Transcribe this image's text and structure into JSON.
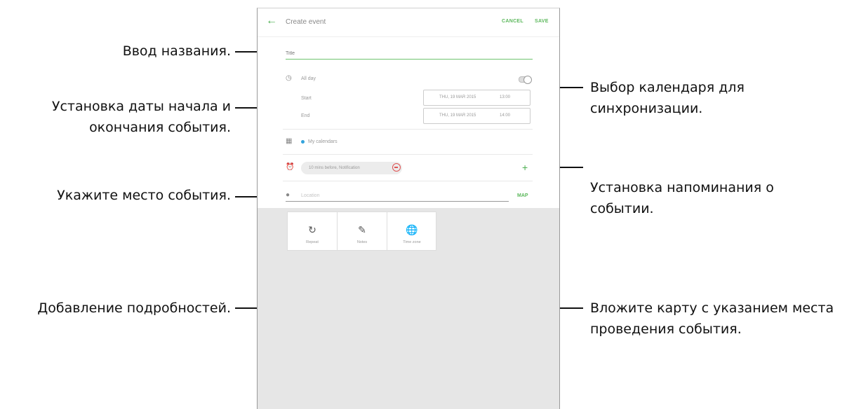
{
  "callouts": {
    "title_input": "Ввод названия.",
    "dates_line1": "Установка даты начала и",
    "dates_line2": "окончания события.",
    "location": "Укажите место события.",
    "details": "Добавление подробностей.",
    "calendar_line1": "Выбор календаря для",
    "calendar_line2": "синхронизации.",
    "reminder_line1": "Установка напоминания о",
    "reminder_line2": "событии.",
    "map_line1": "Вложите карту с указанием места",
    "map_line2": "проведения события."
  },
  "app": {
    "title": "Create event",
    "cancel": "CANCEL",
    "save": "SAVE",
    "title_placeholder": "Title",
    "all_day": "All day",
    "start_label": "Start",
    "end_label": "End",
    "start_date": "THU, 19 MAR 2015",
    "start_time": "13:00",
    "end_date": "THU, 19 MAR 2015",
    "end_time": "14:00",
    "calendar": "My calendars",
    "reminder": "10 mins before, Notification",
    "location_placeholder": "Location",
    "map": "MAP",
    "details": [
      {
        "label": "Repeat",
        "icon": "repeat-icon"
      },
      {
        "label": "Notes",
        "icon": "notes-icon"
      },
      {
        "label": "Time zone",
        "icon": "timezone-icon"
      }
    ]
  },
  "colors": {
    "accent": "#4caf50",
    "calendar_dot": "#33a3dc",
    "remove": "#e05555"
  }
}
